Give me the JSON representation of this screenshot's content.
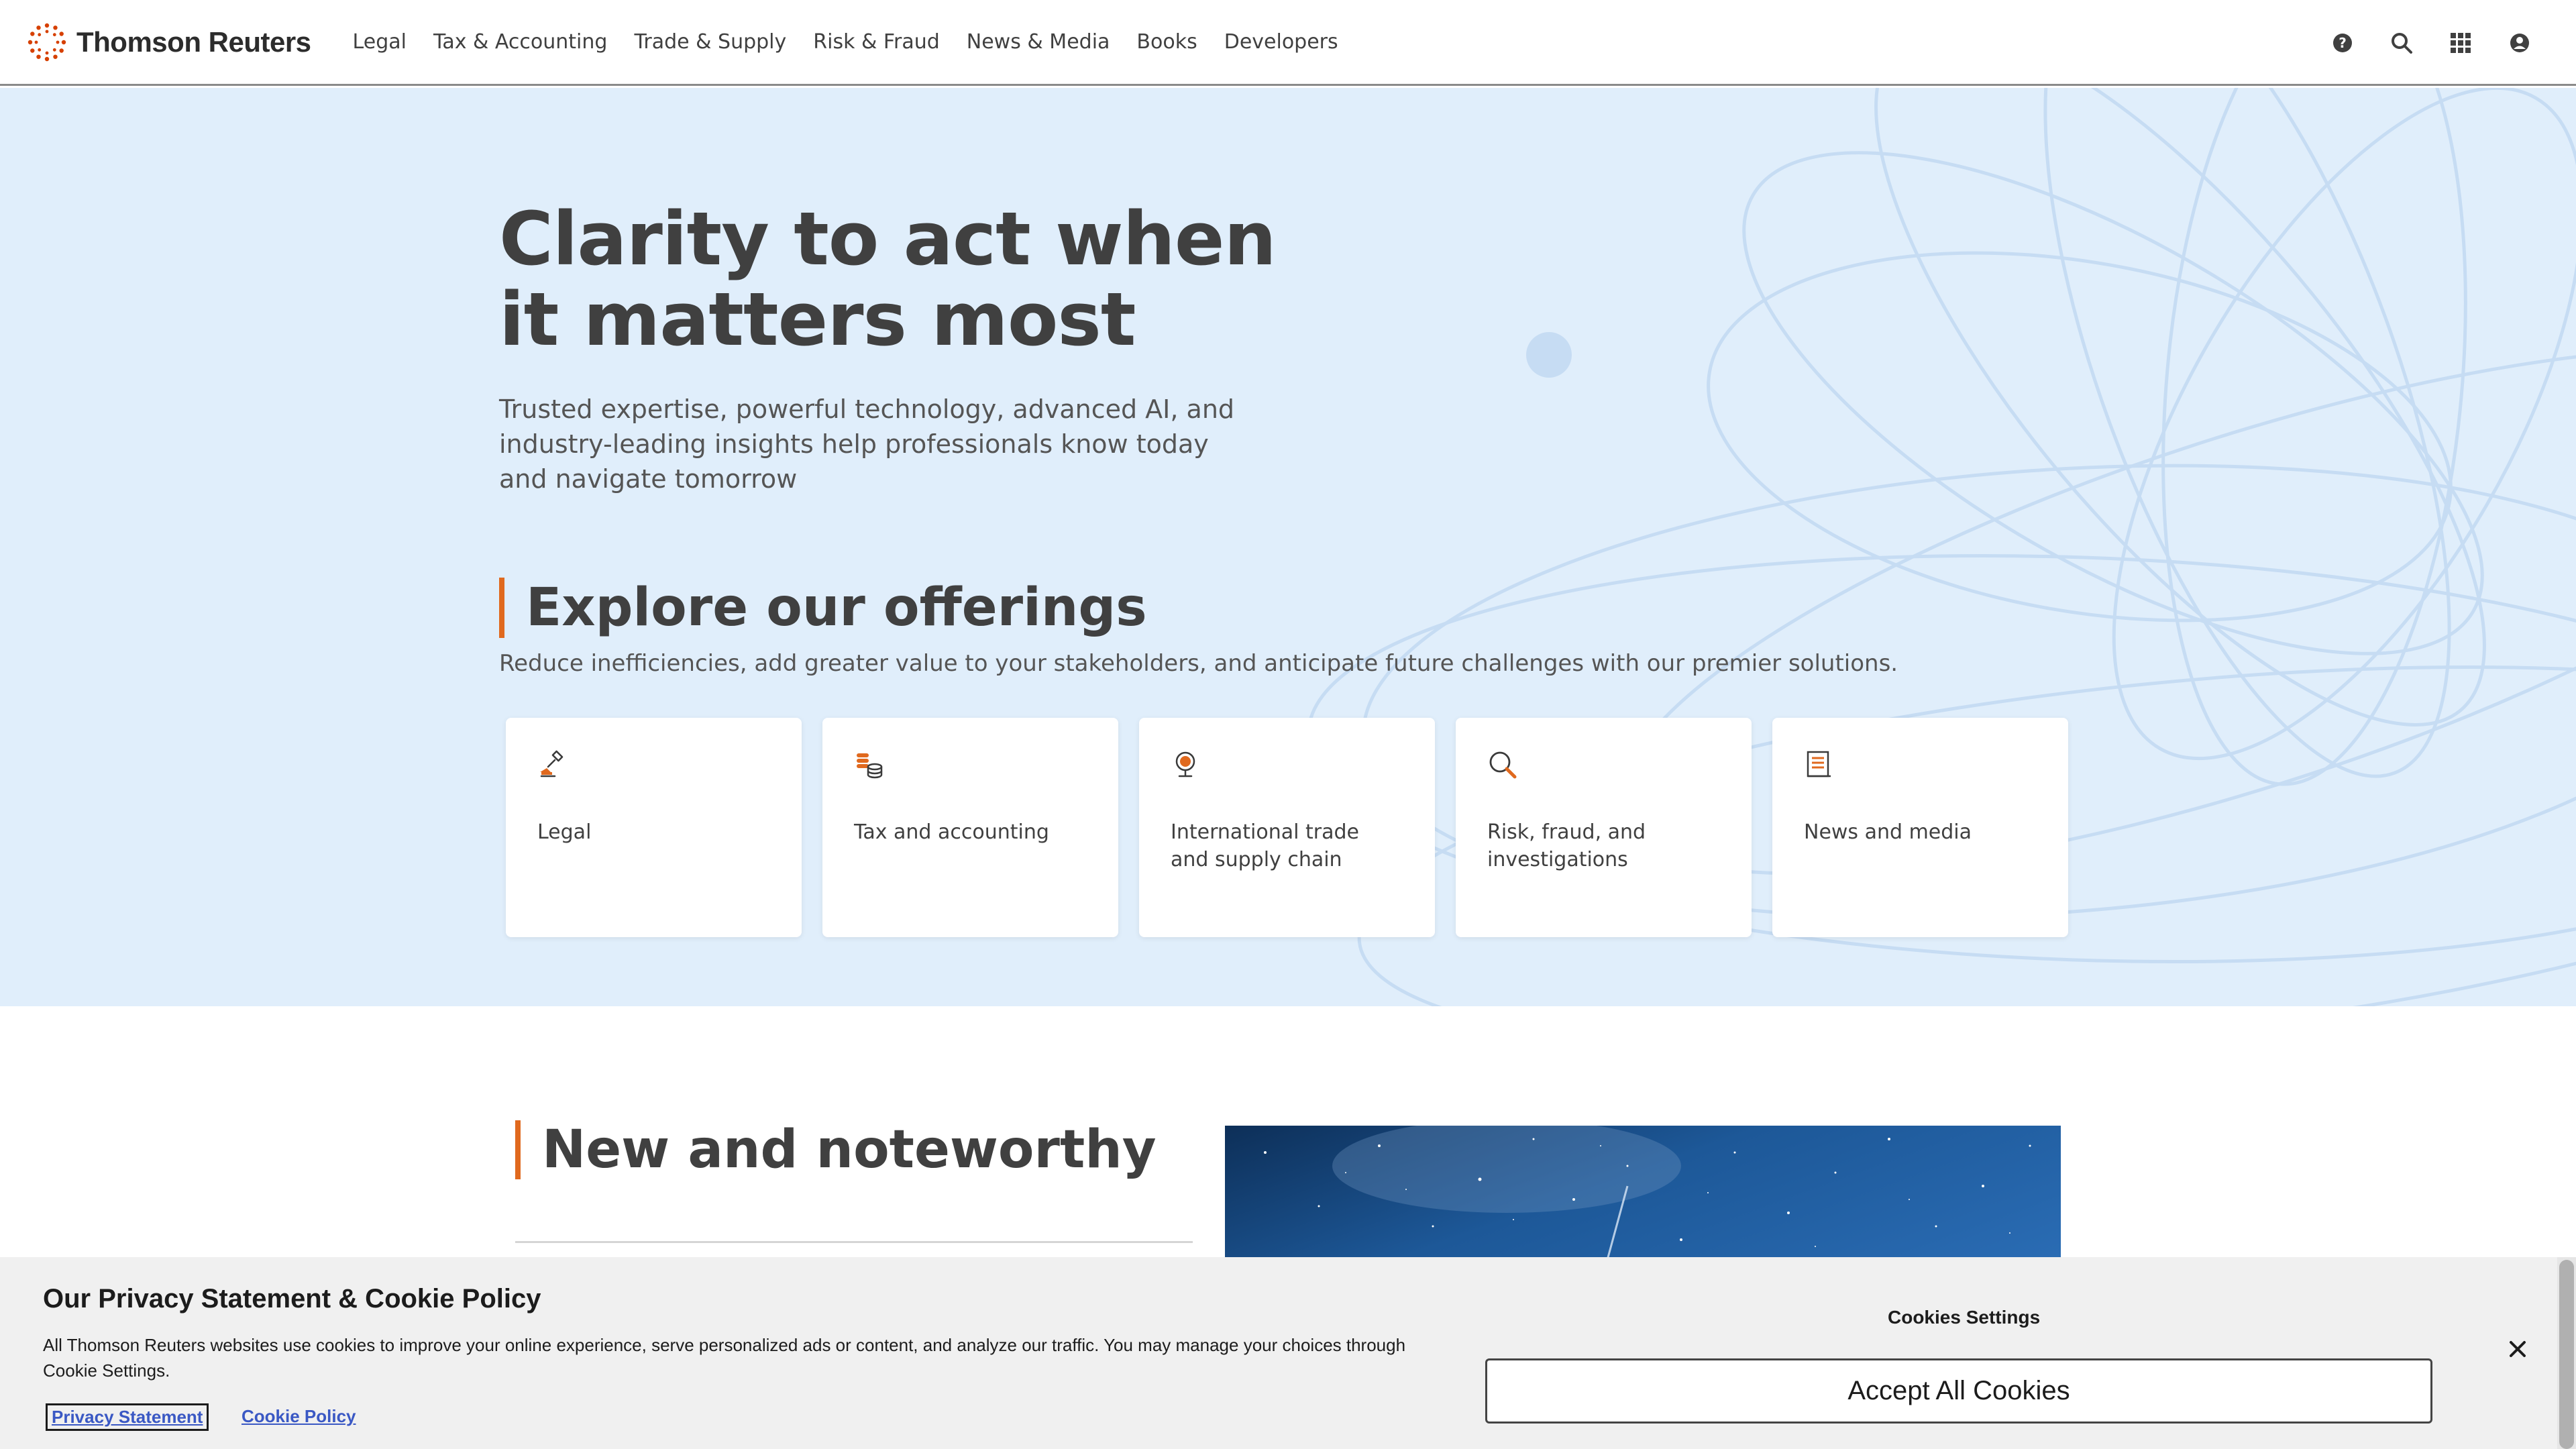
{
  "header": {
    "brand": "Thomson Reuters",
    "nav": [
      "Legal",
      "Tax & Accounting",
      "Trade & Supply",
      "Risk & Fraud",
      "News & Media",
      "Books",
      "Developers"
    ],
    "icons": [
      "help-icon",
      "search-icon",
      "apps-grid-icon",
      "account-icon"
    ]
  },
  "hero": {
    "title": "Clarity to act when it matters most",
    "subtitle": "Trusted expertise, powerful technology, advanced AI, and industry-leading insights help professionals know today and navigate tomorrow"
  },
  "offerings": {
    "title": "Explore our offerings",
    "subtitle": "Reduce inefficiencies, add greater value to your stakeholders, and anticipate future challenges with our premier solutions.",
    "cards": [
      {
        "label": "Legal",
        "icon": "gavel-icon"
      },
      {
        "label": "Tax and accounting",
        "icon": "coins-icon"
      },
      {
        "label": "International trade and supply chain",
        "icon": "globe-icon"
      },
      {
        "label": "Risk, fraud, and investigations",
        "icon": "magnifier-icon"
      },
      {
        "label": "News and media",
        "icon": "newspaper-icon"
      }
    ]
  },
  "noteworthy": {
    "title": "New and noteworthy"
  },
  "cookie": {
    "title": "Our Privacy Statement & Cookie Policy",
    "text": "All Thomson Reuters websites use cookies to improve your online experience, serve personalized ads or content, and analyze our traffic. You may manage your choices through Cookie Settings.",
    "privacy_link": "Privacy Statement",
    "policy_link": "Cookie Policy",
    "settings_label": "Cookies Settings",
    "accept_label": "Accept All Cookies"
  },
  "colors": {
    "accent": "#e0691e",
    "hero_bg": "#e0eefb",
    "link": "#3a58c4"
  }
}
